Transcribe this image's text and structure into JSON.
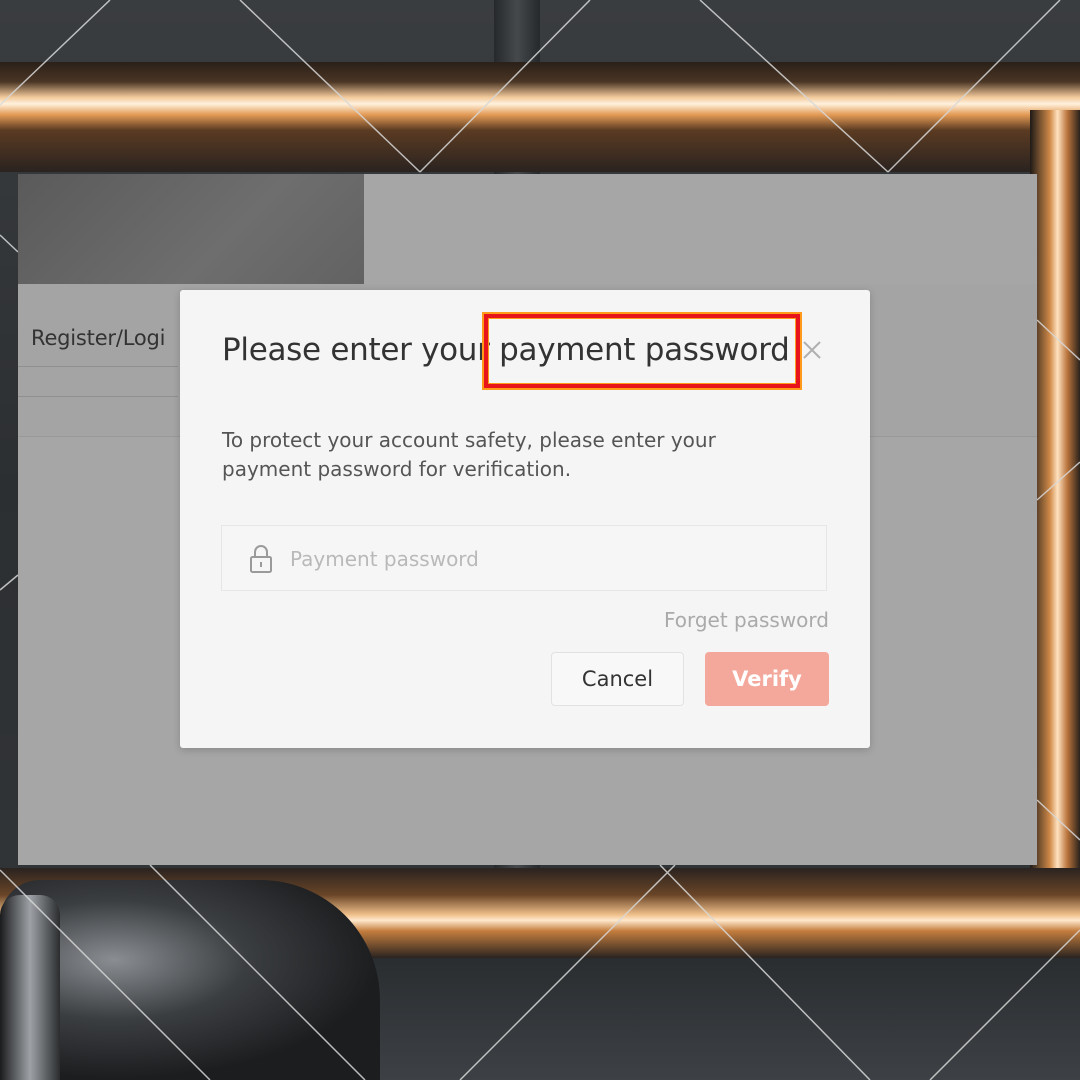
{
  "page": {
    "register_login_label": "Register/Logi"
  },
  "dialog": {
    "title": "Please enter your payment password",
    "highlighted_text": "payment password",
    "description": "To protect your account safety, please enter your payment password for verification.",
    "password_placeholder": "Payment password",
    "password_value": "",
    "forget_label": "Forget password",
    "cancel_label": "Cancel",
    "verify_label": "Verify",
    "close_icon": "close-icon",
    "lock_icon": "lock-icon"
  },
  "colors": {
    "verify_button": "#f4a89c",
    "highlight_border": "#e8141b",
    "highlight_glow": "#ff9a1a"
  }
}
